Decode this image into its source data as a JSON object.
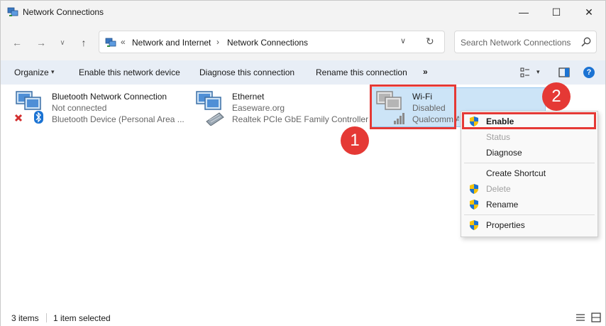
{
  "window": {
    "title": "Network Connections",
    "min_glyph": "—",
    "max_glyph": "☐",
    "close_glyph": "✕"
  },
  "nav": {
    "back_glyph": "←",
    "forward_glyph": "→",
    "recent_glyph": "∨",
    "up_glyph": "↑"
  },
  "address": {
    "overflow_glyph": "«",
    "crumbs": [
      "Network and Internet",
      "Network Connections"
    ],
    "separator": "›",
    "dropdown_glyph": "∨",
    "refresh_glyph": "↻"
  },
  "search": {
    "placeholder": "Search Network Connections"
  },
  "commands": {
    "organize": "Organize",
    "enable_device": "Enable this network device",
    "diagnose": "Diagnose this connection",
    "rename": "Rename this connection",
    "more": "»",
    "caret": "▾",
    "help": "?"
  },
  "connections": [
    {
      "name": "Bluetooth Network Connection",
      "status": "Not connected",
      "device": "Bluetooth Device (Personal Area ..."
    },
    {
      "name": "Ethernet",
      "status": "Easeware.org",
      "device": "Realtek PCIe GbE Family Controller"
    },
    {
      "name": "Wi-Fi",
      "status": "Disabled",
      "device": "Qualcomm A"
    }
  ],
  "context_menu": {
    "items": [
      {
        "label": "Enable",
        "bold": true,
        "disabled": false,
        "shield": true
      },
      {
        "label": "Status",
        "bold": false,
        "disabled": true,
        "shield": false
      },
      {
        "label": "Diagnose",
        "bold": false,
        "disabled": false,
        "shield": false
      },
      {
        "label": "Create Shortcut",
        "bold": false,
        "disabled": false,
        "shield": false
      },
      {
        "label": "Delete",
        "bold": false,
        "disabled": true,
        "shield": true
      },
      {
        "label": "Rename",
        "bold": false,
        "disabled": false,
        "shield": true
      },
      {
        "label": "Properties",
        "bold": false,
        "disabled": false,
        "shield": true
      }
    ]
  },
  "annotations": {
    "step1": "1",
    "step2": "2",
    "color": "#e53935"
  },
  "statusbar": {
    "count": "3 items",
    "selected": "1 item selected"
  },
  "colors": {
    "selection": "#cce4f7",
    "commandbar": "#e8eef6",
    "accent": "#1b73d3"
  }
}
